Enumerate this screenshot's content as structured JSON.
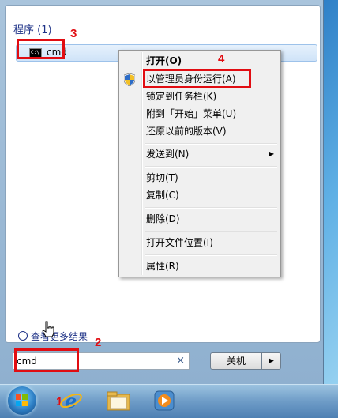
{
  "start_menu": {
    "programs_header": "程序 (1)",
    "result": {
      "label": "cmd",
      "icon": "cmd-icon"
    },
    "search_more": "查看更多结果",
    "search": {
      "value": "cmd",
      "clear_glyph": "×"
    },
    "shutdown_label": "关机",
    "shutdown_arrow": "▶"
  },
  "context_menu": {
    "items": [
      {
        "label": "打开(O)",
        "bold": true
      },
      {
        "label": "以管理员身份运行(A)",
        "icon": "uac-shield-icon"
      },
      {
        "label": "锁定到任务栏(K)"
      },
      {
        "label": "附到「开始」菜单(U)"
      },
      {
        "label": "还原以前的版本(V)"
      },
      {
        "label": "发送到(N)",
        "submenu_glyph": "▶"
      },
      {
        "label": "剪切(T)"
      },
      {
        "label": "复制(C)"
      },
      {
        "label": "删除(D)"
      },
      {
        "label": "打开文件位置(I)"
      },
      {
        "label": "属性(R)"
      }
    ]
  },
  "annotations": {
    "step1": "1",
    "step2": "2",
    "step3": "3",
    "step4": "4"
  },
  "taskbar": {
    "icons": [
      "start-orb-icon",
      "internet-explorer-icon",
      "windows-explorer-icon",
      "media-player-icon"
    ]
  },
  "colors": {
    "annotation_red": "#e10d12",
    "header_blue": "#1e3287"
  }
}
